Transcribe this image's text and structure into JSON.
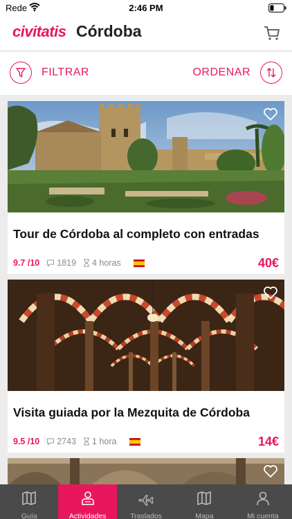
{
  "status_bar": {
    "carrier": "Rede",
    "time": "2:46 PM"
  },
  "header": {
    "logo": "civitatis",
    "city": "Córdoba",
    "cart_icon": "cart-icon"
  },
  "filter_bar": {
    "filter_label": "FILTRAR",
    "order_label": "ORDENAR"
  },
  "colors": {
    "accent": "#e8175d",
    "tab_bar": "#4a4a4a",
    "background": "#ececec"
  },
  "cards": [
    {
      "title": "Tour de Córdoba al completo con entradas",
      "rating": "9.7 /10",
      "reviews": "1819",
      "duration": "4 horas",
      "language": "es",
      "price": "40€"
    },
    {
      "title": "Visita guiada por la Mezquita de Córdoba",
      "rating": "9.5 /10",
      "reviews": "2743",
      "duration": "1 hora",
      "language": "es",
      "price": "14€"
    }
  ],
  "tabs": [
    {
      "label": "Guía",
      "icon": "map-book-icon",
      "active": false
    },
    {
      "label": "Actividades",
      "icon": "person-icon",
      "active": true
    },
    {
      "label": "Traslados",
      "icon": "airplane-icon",
      "active": false
    },
    {
      "label": "Mapa",
      "icon": "map-icon",
      "active": false
    },
    {
      "label": "Mi cuenta",
      "icon": "user-icon",
      "active": false
    }
  ]
}
